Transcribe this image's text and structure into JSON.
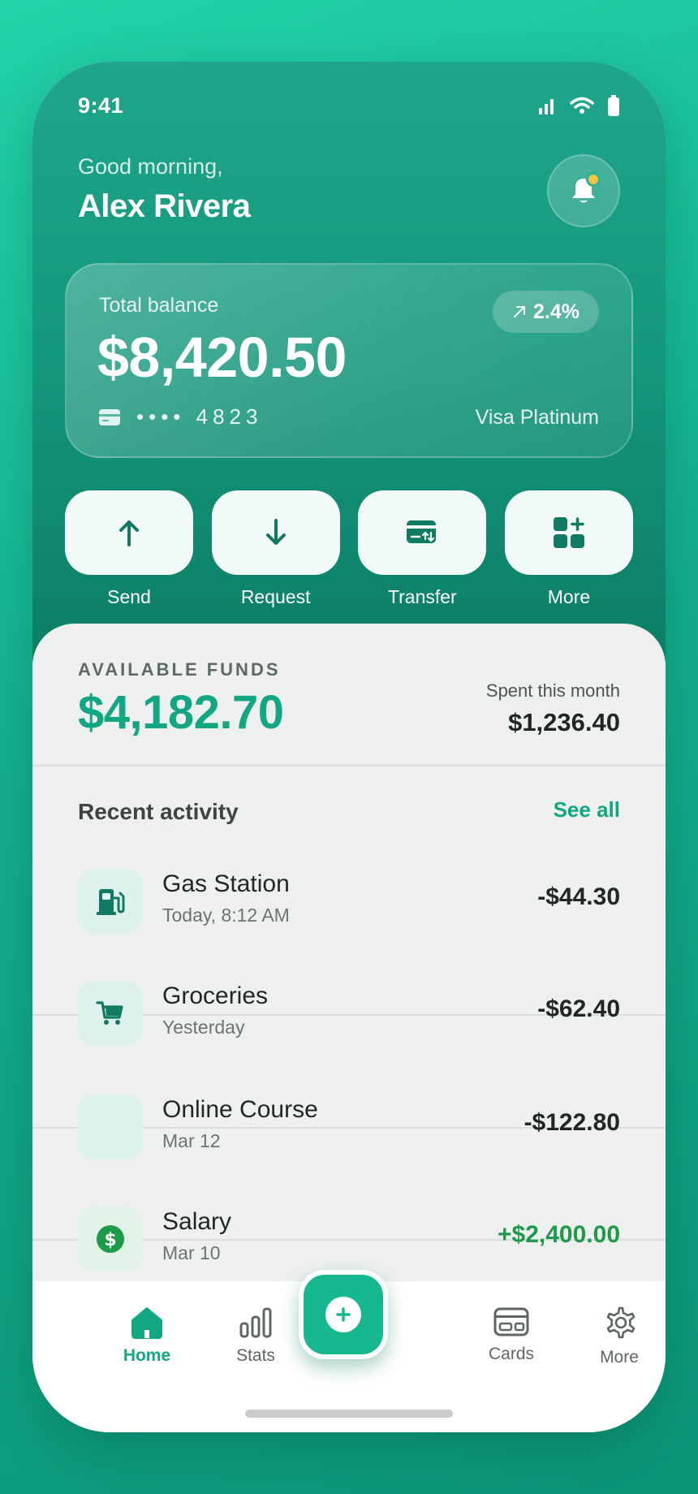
{
  "status_bar": {
    "time": "9:41"
  },
  "header": {
    "greeting": "Good morning,",
    "user_name": "Alex Rivera"
  },
  "balance_card": {
    "label": "Total balance",
    "amount": "$8,420.50",
    "trend": "2.4%",
    "card_number": "•••• 4823",
    "card_type": "Visa Platinum"
  },
  "actions": [
    {
      "label": "Send",
      "icon": "arrow-up-icon"
    },
    {
      "label": "Request",
      "icon": "arrow-down-icon"
    },
    {
      "label": "Transfer",
      "icon": "card-transfer-icon"
    },
    {
      "label": "More",
      "icon": "grid-plus-icon"
    }
  ],
  "funds": {
    "label": "AVAILABLE FUNDS",
    "amount": "$4,182.70",
    "spent_label": "Spent this month",
    "spent_amount": "$1,236.40"
  },
  "activity": {
    "title": "Recent activity",
    "see_all": "See all",
    "transactions": [
      {
        "name": "Gas Station",
        "sub": "Today, 8:12 AM",
        "amount": "-$44.30",
        "icon": "fuel-icon"
      },
      {
        "name": "Groceries",
        "sub": "Yesterday",
        "amount": "-$62.40",
        "icon": "cart-icon"
      },
      {
        "name": "Online Course",
        "sub": "Mar 12",
        "amount": "-$122.80",
        "icon": "course-icon"
      },
      {
        "name": "Salary",
        "sub": "Mar 10",
        "amount": "+$2,400.00",
        "icon": "dollar-icon"
      }
    ]
  },
  "tabbar": {
    "home": "Home",
    "stats": "Stats",
    "cards": "Cards",
    "more": "More"
  },
  "colors": {
    "accent": "#12a783",
    "positive": "#1e9a4b",
    "notification": "#f4c542"
  }
}
